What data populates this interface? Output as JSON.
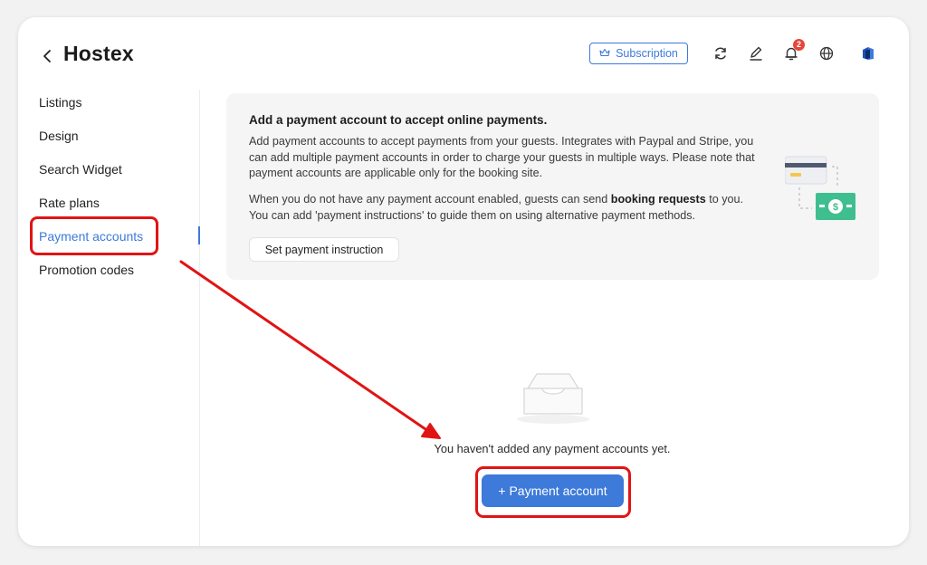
{
  "header": {
    "title": "Hostex",
    "subscription_label": "Subscription",
    "notification_count": "2",
    "icons": [
      "back-chevron-icon",
      "refresh-icon",
      "edit-icon",
      "bell-icon",
      "globe-icon",
      "app-logo-icon"
    ]
  },
  "sidebar": {
    "items": [
      {
        "label": "Listings"
      },
      {
        "label": "Design"
      },
      {
        "label": "Search Widget"
      },
      {
        "label": "Rate plans"
      },
      {
        "label": "Payment accounts",
        "active": true
      },
      {
        "label": "Promotion codes"
      }
    ]
  },
  "info": {
    "title": "Add a payment account to accept online payments.",
    "paragraph1": "Add payment accounts to accept payments from your guests. Integrates with Paypal and Stripe, you can add multiple payment accounts in order to charge your guests in multiple ways. Please note that payment accounts are applicable only for the booking site.",
    "paragraph2_before": "When you do not have any payment account enabled, guests can send ",
    "paragraph2_bold": "booking requests",
    "paragraph2_after": " to you. You can add 'payment instructions' to guide them on using alternative payment methods.",
    "button_label": "Set payment instruction"
  },
  "empty_state": {
    "message": "You haven't added any payment accounts yet.",
    "button_label": "+ Payment account"
  },
  "colors": {
    "accent": "#3d7ad9",
    "annotation": "#e11414",
    "badge": "#e8443a",
    "money_green": "#3fbf8f"
  }
}
